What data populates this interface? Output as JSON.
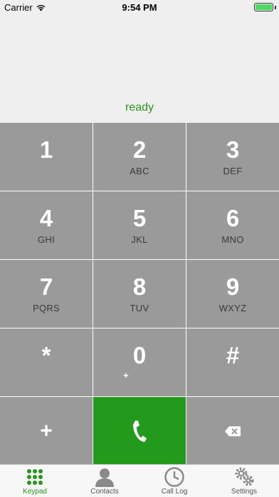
{
  "status_bar": {
    "carrier": "Carrier",
    "time": "9:54 PM",
    "battery_color": "#4cd964"
  },
  "display": {
    "status": "ready",
    "status_color": "#27961c"
  },
  "keypad": {
    "keys": [
      {
        "digit": "1",
        "letters": ""
      },
      {
        "digit": "2",
        "letters": "ABC"
      },
      {
        "digit": "3",
        "letters": "DEF"
      },
      {
        "digit": "4",
        "letters": "GHI"
      },
      {
        "digit": "5",
        "letters": "JKL"
      },
      {
        "digit": "6",
        "letters": "MNO"
      },
      {
        "digit": "7",
        "letters": "PQRS"
      },
      {
        "digit": "8",
        "letters": "TUV"
      },
      {
        "digit": "9",
        "letters": "WXYZ"
      },
      {
        "digit": "*",
        "letters": ""
      },
      {
        "digit": "0",
        "letters": "",
        "secondary": "+"
      },
      {
        "digit": "#",
        "letters": ""
      }
    ],
    "plus_label": "+",
    "key_color": "#9a9a9a",
    "call_color": "#239a1c"
  },
  "tab_bar": {
    "tabs": [
      {
        "label": "Keypad",
        "icon": "keypad-icon",
        "active": true
      },
      {
        "label": "Contacts",
        "icon": "contacts-icon",
        "active": false
      },
      {
        "label": "Call Log",
        "icon": "clock-icon",
        "active": false
      },
      {
        "label": "Settings",
        "icon": "gears-icon",
        "active": false
      }
    ],
    "active_color": "#27961c"
  }
}
